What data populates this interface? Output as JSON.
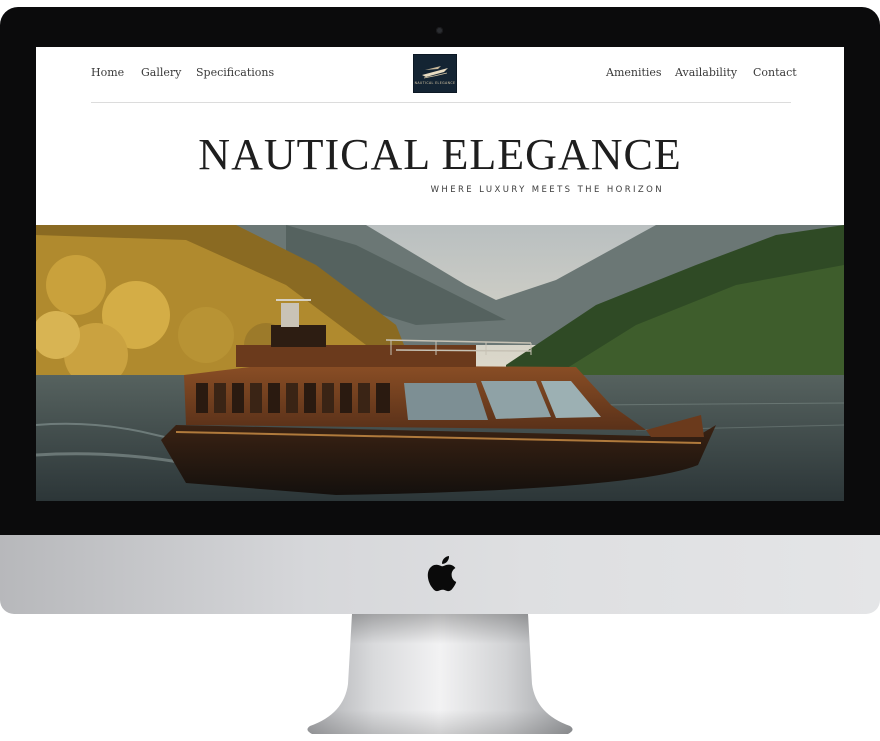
{
  "nav": {
    "left": [
      "Home",
      "Gallery",
      "Specifications"
    ],
    "right": [
      "Amenities",
      "Availability",
      "Contact"
    ]
  },
  "logo": {
    "text": "NAUTICAL ELEGANCE",
    "icon": "yacht-logo-icon"
  },
  "hero": {
    "title": "NAUTICAL ELEGANCE",
    "tagline": "WHERE LUXURY MEETS THE HORIZON",
    "image": "wooden-yacht-on-mountain-lake-photo"
  },
  "device": {
    "type": "desktop-monitor",
    "brand_icon": "apple-icon"
  },
  "colors": {
    "text": "#1e1e1e",
    "logo_bg": "#142433",
    "bezel": "#0b0b0c"
  }
}
